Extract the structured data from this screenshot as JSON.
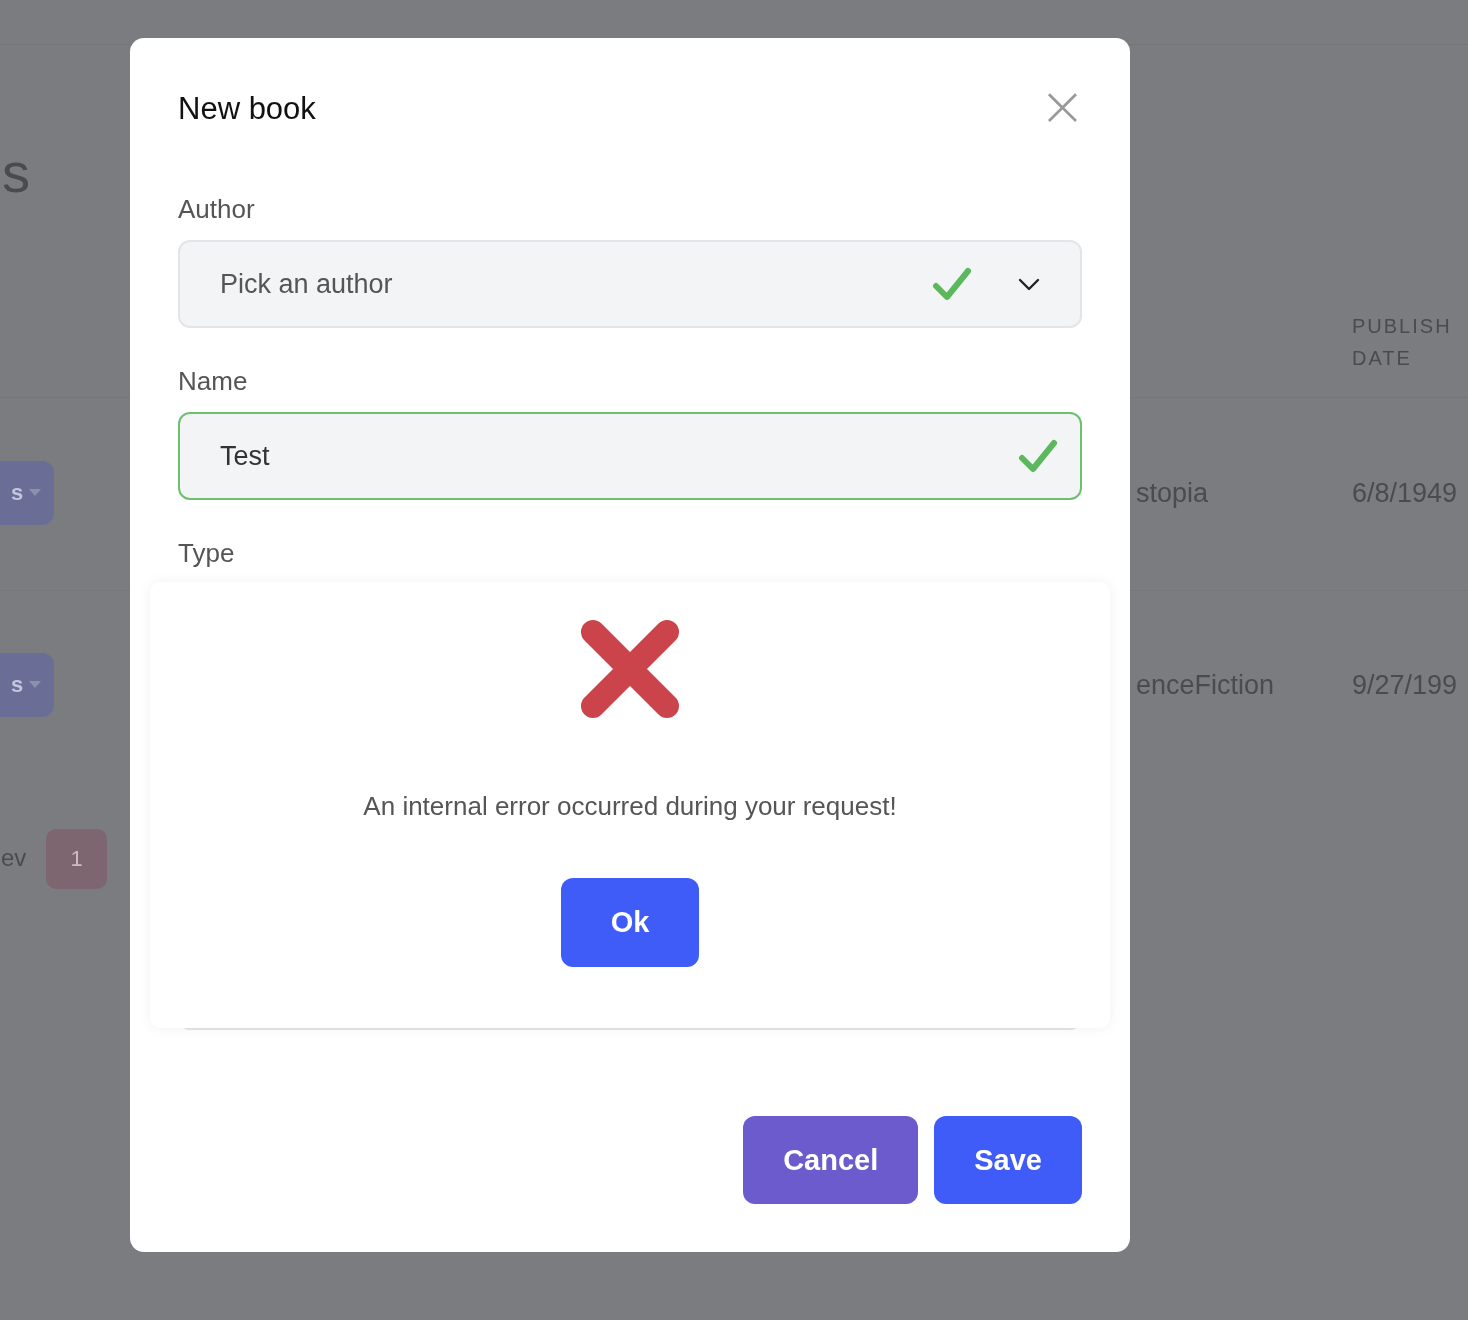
{
  "background_page": {
    "title": "s",
    "table": {
      "header": "PUBLISH DATE",
      "rows": [
        {
          "column_1": "stopia",
          "publish_date": "6/8/1949",
          "action": "s"
        },
        {
          "column_1": "enceFiction",
          "publish_date": "9/27/199",
          "action": "s"
        }
      ]
    },
    "pagination": {
      "prev": "ev",
      "pages": [
        {
          "label": "1",
          "selected": true
        }
      ]
    }
  },
  "dialog": {
    "title": "New book",
    "close": "×",
    "fields": [
      {
        "kind": "select",
        "label": "Author",
        "placeholder": "Pick an author",
        "valid": true,
        "focused": false
      },
      {
        "kind": "text",
        "label": "Name",
        "value": "Test",
        "valid": true,
        "focused": true
      },
      {
        "kind": "select",
        "label": "Type"
      }
    ],
    "buttons": [
      {
        "label": "Cancel",
        "kind": "secondary"
      },
      {
        "label": "Save",
        "kind": "primary"
      }
    ]
  },
  "alert": {
    "kind": "error",
    "message": "An internal error occurred during your request!",
    "button": "Ok"
  }
}
